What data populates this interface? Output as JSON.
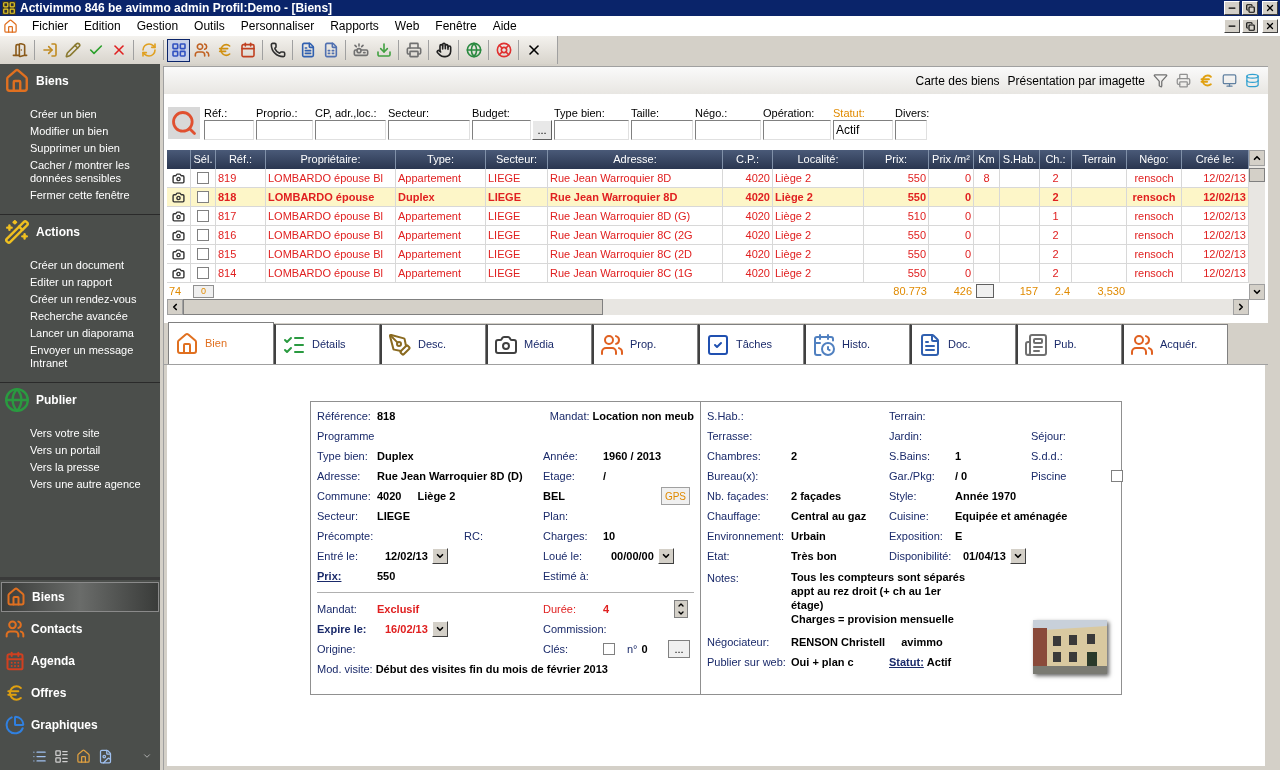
{
  "window": {
    "title": "Activimmo 846 be avimmo admin Profil:Demo - [Biens]"
  },
  "menu": [
    "Fichier",
    "Edition",
    "Gestion",
    "Outils",
    "Personnaliser",
    "Rapports",
    "Web",
    "Fenêtre",
    "Aide"
  ],
  "toolbar": [
    {
      "pressed": false
    },
    {
      "pressed": false
    },
    {
      "pressed": false
    },
    {
      "pressed": false
    },
    {
      "pressed": false
    },
    {
      "pressed": false
    },
    {
      "pressed": true
    },
    {
      "pressed": false
    },
    {
      "pressed": false
    },
    {
      "pressed": false
    },
    {
      "pressed": false
    },
    {
      "pressed": false
    },
    {
      "pressed": false
    },
    {
      "pressed": false
    },
    {
      "pressed": false
    },
    {
      "pressed": false
    },
    {
      "pressed": false
    },
    {
      "pressed": false
    },
    {
      "pressed": false
    },
    {
      "pressed": false
    }
  ],
  "sidebar": {
    "sections": [
      {
        "title": "Biens",
        "items": [
          "Créer un bien",
          "Modifier un bien",
          "Supprimer un bien",
          "Cacher / montrer les données sensibles",
          "Fermer cette fenêtre"
        ]
      },
      {
        "title": "Actions",
        "items": [
          "Créer un document",
          "Editer un rapport",
          "Créer un rendez-vous",
          "Recherche avancée",
          "Lancer un diaporama",
          "Envoyer un message Intranet"
        ]
      },
      {
        "title": "Publier",
        "items": [
          "Vers votre site",
          "Vers un portail",
          "Vers la presse",
          "Vers une autre agence"
        ]
      }
    ],
    "nav": [
      {
        "label": "Biens",
        "selected": true
      },
      {
        "label": "Contacts",
        "selected": false
      },
      {
        "label": "Agenda",
        "selected": false
      },
      {
        "label": "Offres",
        "selected": false
      },
      {
        "label": "Graphiques",
        "selected": false
      }
    ]
  },
  "top_links": [
    "Carte des biens",
    "Présentation par imagette"
  ],
  "filters": [
    {
      "label": "Réf.:"
    },
    {
      "label": "Proprio.:"
    },
    {
      "label": "CP, adr.,loc.:"
    },
    {
      "label": "Secteur:"
    },
    {
      "label": "Budget:",
      "button": "..."
    },
    {
      "label": "Type bien:"
    },
    {
      "label": "Taille:"
    },
    {
      "label": "Négo.:"
    },
    {
      "label": "Opération:"
    },
    {
      "label": "Statut:",
      "value": "Actif",
      "highlight": true
    },
    {
      "label": "Divers:"
    }
  ],
  "table": {
    "columns": [
      "Sél.",
      "Réf.:",
      "Propriétaire:",
      "Type:",
      "Secteur:",
      "Adresse:",
      "C.P.:",
      "Localité:",
      "Prix:",
      "Prix /m²",
      "Km",
      "S.Hab.",
      "Ch.:",
      "Terrain",
      "Négo:",
      "Créé le:"
    ],
    "rows": [
      {
        "selected": false,
        "checked": false,
        "ref": "819",
        "owner": "LOMBARDO épouse Bl",
        "type": "Appartement",
        "sector": "LIEGE",
        "address": "Rue Jean Warroquier 8D",
        "cp": "4020",
        "locality": "Liège 2",
        "price": "550",
        "price_m2": "0",
        "km": "8",
        "ch": "2",
        "nego": "rensoch",
        "created": "12/02/13"
      },
      {
        "selected": true,
        "checked": false,
        "ref": "818",
        "owner": "LOMBARDO épouse",
        "type": "Duplex",
        "sector": "LIEGE",
        "address": "Rue Jean Warroquier 8D",
        "cp": "4020",
        "locality": "Liège 2",
        "price": "550",
        "price_m2": "0",
        "ch": "2",
        "nego": "rensoch",
        "created": "12/02/13"
      },
      {
        "selected": false,
        "checked": false,
        "ref": "817",
        "owner": "LOMBARDO épouse Bl",
        "type": "Appartement",
        "sector": "LIEGE",
        "address": "Rue Jean Warroquier 8D (G)",
        "cp": "4020",
        "locality": "Liège 2",
        "price": "510",
        "price_m2": "0",
        "ch": "1",
        "nego": "rensoch",
        "created": "12/02/13"
      },
      {
        "selected": false,
        "checked": false,
        "ref": "816",
        "owner": "LOMBARDO épouse Bl",
        "type": "Appartement",
        "sector": "LIEGE",
        "address": "Rue Jean Warroquier 8C (2G",
        "cp": "4020",
        "locality": "Liège 2",
        "price": "550",
        "price_m2": "0",
        "ch": "2",
        "nego": "rensoch",
        "created": "12/02/13"
      },
      {
        "selected": false,
        "checked": false,
        "ref": "815",
        "owner": "LOMBARDO épouse Bl",
        "type": "Appartement",
        "sector": "LIEGE",
        "address": "Rue Jean Warroquier 8C (2D",
        "cp": "4020",
        "locality": "Liège 2",
        "price": "550",
        "price_m2": "0",
        "ch": "2",
        "nego": "rensoch",
        "created": "12/02/13"
      },
      {
        "selected": false,
        "checked": false,
        "ref": "814",
        "owner": "LOMBARDO épouse Bl",
        "type": "Appartement",
        "sector": "LIEGE",
        "address": "Rue Jean Warroquier 8C (1G",
        "cp": "4020",
        "locality": "Liège 2",
        "price": "550",
        "price_m2": "0",
        "ch": "2",
        "nego": "rensoch",
        "created": "12/02/13"
      }
    ],
    "footer": {
      "count": "74",
      "page": "0",
      "price": "80.773",
      "price_m2": "426",
      "shab": "157",
      "ch": "2.4",
      "terrain": "3,530"
    }
  },
  "tabs": [
    {
      "label": "Bien",
      "selected": true
    },
    {
      "label": "Détails",
      "selected": false
    },
    {
      "label": "Desc.",
      "selected": false
    },
    {
      "label": "Média",
      "selected": false
    },
    {
      "label": "Prop.",
      "selected": false
    },
    {
      "label": "Tâches",
      "selected": false
    },
    {
      "label": "Histo.",
      "selected": false
    },
    {
      "label": "Doc.",
      "selected": false
    },
    {
      "label": "Pub.",
      "selected": false
    },
    {
      "label": "Acquér.",
      "selected": false
    }
  ],
  "form": {
    "left": [
      [
        {
          "cells": [
            {
              "kind": "field",
              "label": "Référence:",
              "value": "818"
            },
            {
              "kind": "inline",
              "label": "Mandat:",
              "value": "Location non meub"
            }
          ]
        },
        {
          "cells": [
            {
              "kind": "field",
              "label": "Programme"
            }
          ]
        },
        {
          "cells": [
            {
              "kind": "field",
              "label": "Type bien:",
              "value": "Duplex"
            },
            {
              "kind": "field",
              "label": "Année:",
              "value": "1960 / 2013"
            }
          ]
        },
        {
          "cells": [
            {
              "kind": "field",
              "label": "Adresse:",
              "value": "Rue Jean Warroquier 8D (D)"
            },
            {
              "kind": "field",
              "label": "Etage:",
              "value": "/"
            }
          ]
        },
        {
          "cells": [
            {
              "kind": "field",
              "label": "Commune:",
              "value": "4020",
              "extra": "Liège 2"
            },
            {
              "kind": "value_button",
              "value": "BEL",
              "button": "GPS"
            }
          ]
        },
        {
          "cells": [
            {
              "kind": "field",
              "label": "Secteur:",
              "value": "LIEGE"
            },
            {
              "kind": "field",
              "label": "Plan:"
            }
          ]
        },
        {
          "cells": [
            {
              "kind": "field",
              "label": "Précompte:",
              "note": "RC:"
            },
            {
              "kind": "field",
              "label": "Charges:",
              "value": "10"
            }
          ]
        },
        {
          "cells": [
            {
              "kind": "date",
              "label": "Entré le:",
              "value": "12/02/13"
            },
            {
              "kind": "date",
              "label": "Loué le:",
              "value": "00/00/00"
            }
          ]
        },
        {
          "cells": [
            {
              "kind": "field",
              "label": "Prix:",
              "label_link": true,
              "value": "550"
            },
            {
              "kind": "field",
              "label": "Estimé à:"
            }
          ]
        }
      ],
      [
        {
          "cells": [
            {
              "kind": "field",
              "label": "Mandat:",
              "value": "Exclusif",
              "value_alert": true
            },
            {
              "kind": "spinner",
              "label": "Durée:",
              "label_alert": true,
              "value": "4",
              "value_alert": true
            }
          ]
        },
        {
          "cells": [
            {
              "kind": "date",
              "label": "Expire le:",
              "label_bold": true,
              "value": "16/02/13",
              "value_alert": true
            },
            {
              "kind": "field",
              "label": "Commission:"
            }
          ]
        },
        {
          "cells": [
            {
              "kind": "field",
              "label": "Origine:"
            },
            {
              "kind": "keys",
              "label": "Clés:",
              "checked": false,
              "label2": "n°",
              "value": "0",
              "button": "..."
            }
          ]
        },
        {
          "cells": [
            {
              "kind": "inline",
              "label": "Mod. visite:",
              "value": "Début des visites fin du mois de février 2013"
            }
          ]
        }
      ]
    ],
    "right": [
      {
        "cells": [
          {
            "kind": "field",
            "label": "S.Hab.:"
          },
          {
            "kind": "field",
            "label": "Terrain:"
          }
        ]
      },
      {
        "cells": [
          {
            "kind": "field",
            "label": "Terrasse:"
          },
          {
            "kind": "field",
            "label": "Jardin:"
          },
          {
            "kind": "field",
            "label": "Séjour:"
          }
        ]
      },
      {
        "cells": [
          {
            "kind": "field",
            "label": "Chambres:",
            "value": "2"
          },
          {
            "kind": "field",
            "label": "S.Bains:",
            "value": "1"
          },
          {
            "kind": "field",
            "label": "S.d.d.:"
          }
        ]
      },
      {
        "cells": [
          {
            "kind": "field",
            "label": "Bureau(x):"
          },
          {
            "kind": "field",
            "label": "Gar./Pkg:",
            "value": "/ 0"
          },
          {
            "kind": "checkbox",
            "label": "Piscine",
            "checked": false
          }
        ]
      },
      {
        "cells": [
          {
            "kind": "field",
            "label": "Nb. façades:",
            "value": "2 façades"
          },
          {
            "kind": "field",
            "label": "Style:",
            "value": "Année 1970"
          }
        ]
      },
      {
        "cells": [
          {
            "kind": "field",
            "label": "Chauffage:",
            "value": "Central au gaz"
          },
          {
            "kind": "field",
            "label": "Cuisine:",
            "value": "Equipée et aménagée"
          }
        ]
      },
      {
        "cells": [
          {
            "kind": "field",
            "label": "Environnement:",
            "value": "Urbain"
          },
          {
            "kind": "field",
            "label": "Exposition:",
            "value": "E"
          }
        ]
      },
      {
        "cells": [
          {
            "kind": "field",
            "label": "Etat:",
            "value": "Très bon"
          },
          {
            "kind": "date",
            "label": "Disponibilité:",
            "value": "01/04/13"
          }
        ]
      }
    ],
    "notes": {
      "label": "Notes:",
      "text": "Tous les compteurs sont séparés\nappt au rez droit (+ ch au 1er\nétage)\nCharges = provision mensuelle"
    },
    "bottom": [
      {
        "cells": [
          {
            "kind": "field",
            "label": "Négociateur:",
            "value": "RENSON Christell",
            "extra": "avimmo"
          }
        ]
      },
      {
        "cells": [
          {
            "kind": "field",
            "label": "Publier sur web:",
            "value": "Oui + plan c"
          },
          {
            "kind": "inline",
            "label": "Statut:",
            "label_link": true,
            "value": "Actif"
          }
        ]
      }
    ]
  }
}
